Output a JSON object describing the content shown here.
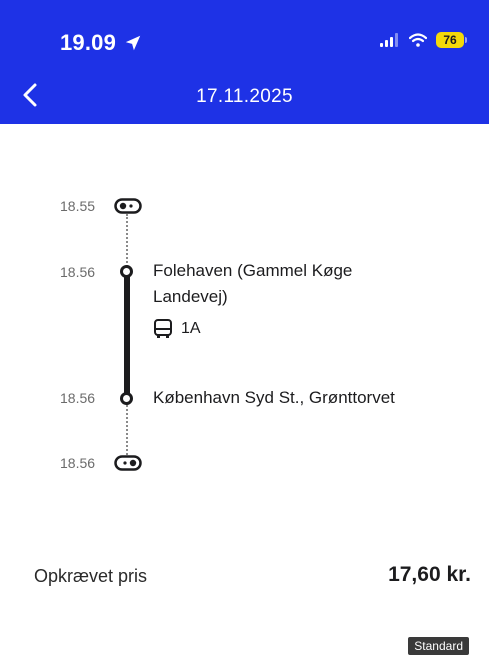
{
  "status_bar": {
    "time": "19.09",
    "battery": "76",
    "icons": [
      "location-arrow-icon",
      "signal-icon",
      "wifi-icon",
      "battery-icon"
    ]
  },
  "nav": {
    "title": "17.11.2025",
    "back_icon": "chevron-left-icon"
  },
  "journey": {
    "start_time": "18.55",
    "end_time": "18.56",
    "stops": [
      {
        "time": "18.56",
        "name": "Folehaven (Gammel Køge Landevej)"
      },
      {
        "time": "18.56",
        "name": "København Syd St., Grønttorvet"
      }
    ],
    "route": {
      "icon": "bus-icon",
      "label": "1A"
    }
  },
  "price": {
    "label": "Opkrævet pris",
    "value": "17,60 kr.",
    "badge": "Standard"
  },
  "colors": {
    "header_bg": "#1e32e6",
    "battery": "#f5d90a"
  }
}
